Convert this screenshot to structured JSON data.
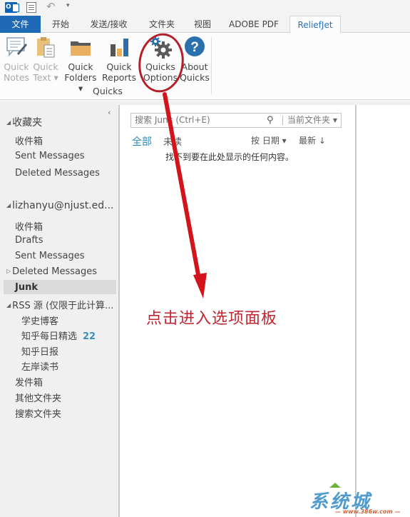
{
  "quick_access": {
    "app_icon": "outlook-icon",
    "send_receive_icon": "send-receive-all-icon",
    "undo_icon": "undo-icon",
    "customize_icon": "customize-qat-icon",
    "undo_glyph": "↶",
    "more_glyph": "▾"
  },
  "tabs": [
    {
      "label": "文件",
      "active": false
    },
    {
      "label": "开始",
      "active": false
    },
    {
      "label": "发送/接收",
      "active": false
    },
    {
      "label": "文件夹",
      "active": false
    },
    {
      "label": "视图",
      "active": false
    },
    {
      "label": "ADOBE PDF",
      "active": false
    },
    {
      "label": "ReliefJet",
      "active": true
    }
  ],
  "ribbon": {
    "group_label": "Quicks",
    "buttons": [
      {
        "line1": "Quick",
        "line2": "Notes",
        "icon": "quick-notes-icon",
        "enabled": false
      },
      {
        "line1": "Quick",
        "line2": "Text ▾",
        "icon": "quick-text-icon",
        "enabled": false
      },
      {
        "line1": "Quick",
        "line2": "Folders ▾",
        "icon": "quick-folders-icon",
        "enabled": true
      },
      {
        "line1": "Quick",
        "line2": "Reports",
        "icon": "quick-reports-icon",
        "enabled": true
      },
      {
        "line1": "Quicks",
        "line2": "Options",
        "icon": "gears-icon",
        "enabled": true,
        "highlighted": true
      },
      {
        "line1": "About",
        "line2": "Quicks",
        "icon": "help-icon",
        "enabled": true
      }
    ]
  },
  "nav": {
    "collapse_glyph": "‹",
    "favorites": {
      "header": "收藏夹",
      "items": [
        "收件箱",
        "Sent Messages",
        "Deleted Messages"
      ]
    },
    "account": {
      "header": "lizhanyu@njust.ed...",
      "items": [
        {
          "label": "收件箱"
        },
        {
          "label": "Drafts"
        },
        {
          "label": "Sent Messages"
        },
        {
          "label": "Deleted Messages",
          "expandable": true
        },
        {
          "label": "Junk",
          "selected": true
        }
      ],
      "rss": {
        "label": "RSS 源 (仅限于此计算...",
        "feeds": [
          {
            "label": "学史博客",
            "count": ""
          },
          {
            "label": "知乎每日精选",
            "count": "22"
          },
          {
            "label": "知乎日报",
            "count": ""
          },
          {
            "label": "左岸读书",
            "count": ""
          }
        ]
      },
      "bottom_items": [
        "发件箱",
        "其他文件夹",
        "搜索文件夹"
      ]
    }
  },
  "message_list": {
    "search_placeholder": "搜索 Junk (Ctrl+E)",
    "search_scope": "当前文件夹",
    "filters": {
      "all": "全部",
      "unread": "未读"
    },
    "sort_by": "按 日期 ▾",
    "sort_order": "最新 ↓",
    "empty_text": "找不到要在此处显示的任何内容。"
  },
  "annotation": {
    "text": "点击进入选项面板",
    "color": "#c0262f"
  },
  "watermark": {
    "brand": "系统城",
    "url": "— www.386w.com —"
  },
  "colors": {
    "file_tab": "#1e6ab6",
    "active_tab_text": "#2a72b8",
    "filter_active": "#2a8ab8",
    "unread_count": "#3a8fc1",
    "annotation": "#c0262f"
  }
}
